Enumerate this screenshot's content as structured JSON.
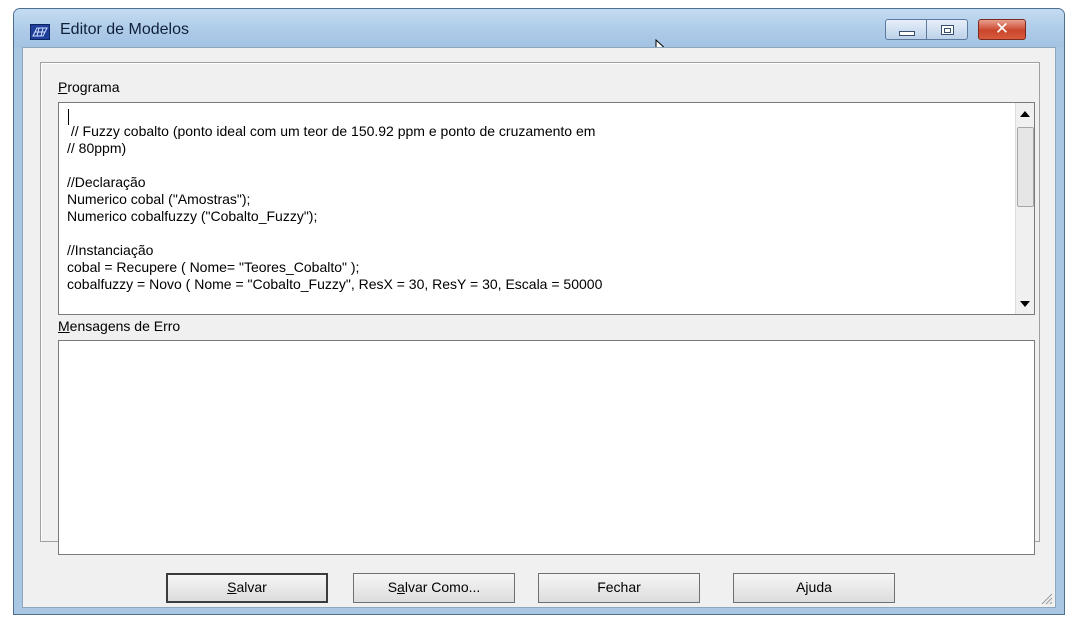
{
  "window": {
    "title": "Editor de Modelos",
    "icon": "grid-app-icon",
    "controls": {
      "minimize": "minimize-icon",
      "maximize": "maximize-icon",
      "close": "close-icon"
    }
  },
  "programa": {
    "label_access": "P",
    "label_rest": "rograma",
    "lines": [
      "",
      " // Fuzzy cobalto (ponto ideal com um teor de 150.92 ppm e ponto de cruzamento em",
      "// 80ppm)",
      "",
      "//Declaração",
      "Numerico cobal (\"Amostras\");",
      "Numerico cobalfuzzy (\"Cobalto_Fuzzy\");",
      "",
      "//Instanciação",
      "cobal = Recupere ( Nome= \"Teores_Cobalto\" );",
      "cobalfuzzy = Novo ( Nome = \"Cobalto_Fuzzy\", ResX = 30, ResY = 30, Escala = 50000"
    ]
  },
  "mensagens": {
    "label_access": "M",
    "label_rest": "ensagens de Erro"
  },
  "buttons": {
    "salvar": {
      "pre": "",
      "access": "S",
      "post": "alvar"
    },
    "salvar_como": {
      "pre": "S",
      "access": "a",
      "post": "lvar Como..."
    },
    "fechar": {
      "label": "Fechar"
    },
    "ajuda": {
      "label": "Ajuda"
    }
  },
  "colors": {
    "frame": "#a9c6e3",
    "client": "#f0f0f0",
    "close_button": "#c9462c"
  }
}
